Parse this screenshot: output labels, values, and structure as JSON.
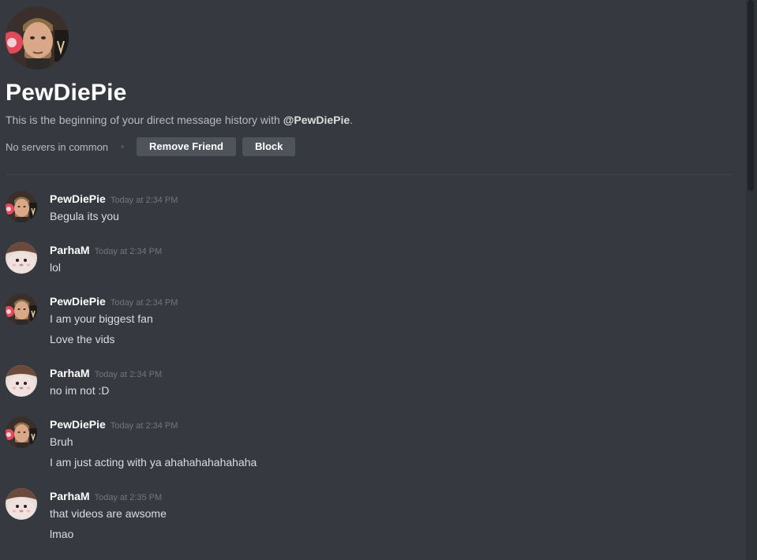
{
  "intro": {
    "title": "PewDiePie",
    "desc_prefix": "This is the beginning of your direct message history with ",
    "desc_handle": "@PewDiePie",
    "desc_suffix": ".",
    "mutual": "No servers in common",
    "remove_friend_label": "Remove Friend",
    "block_label": "Block"
  },
  "messages": [
    {
      "username": "PewDiePie",
      "timestamp": "Today at 2:34 PM",
      "avatar": "pewdiepie-avatar",
      "lines": [
        "Begula its you"
      ]
    },
    {
      "username": "ParhaM",
      "timestamp": "Today at 2:34 PM",
      "avatar": "parham-avatar",
      "lines": [
        "lol"
      ]
    },
    {
      "username": "PewDiePie",
      "timestamp": "Today at 2:34 PM",
      "avatar": "pewdiepie-avatar",
      "lines": [
        "I am your biggest fan",
        "Love the vids"
      ]
    },
    {
      "username": "ParhaM",
      "timestamp": "Today at 2:34 PM",
      "avatar": "parham-avatar",
      "lines": [
        "no im not :D"
      ]
    },
    {
      "username": "PewDiePie",
      "timestamp": "Today at 2:34 PM",
      "avatar": "pewdiepie-avatar",
      "lines": [
        "Bruh",
        "I am just acting with ya ahahahahahahaha"
      ]
    },
    {
      "username": "ParhaM",
      "timestamp": "Today at 2:35 PM",
      "avatar": "parham-avatar",
      "lines": [
        "that videos are awsome",
        "lmao"
      ]
    }
  ],
  "colors": {
    "background": "#36393f",
    "button": "#4f545c",
    "username": "#ffffff",
    "timestamp": "#72767d",
    "text": "#dcddde"
  }
}
